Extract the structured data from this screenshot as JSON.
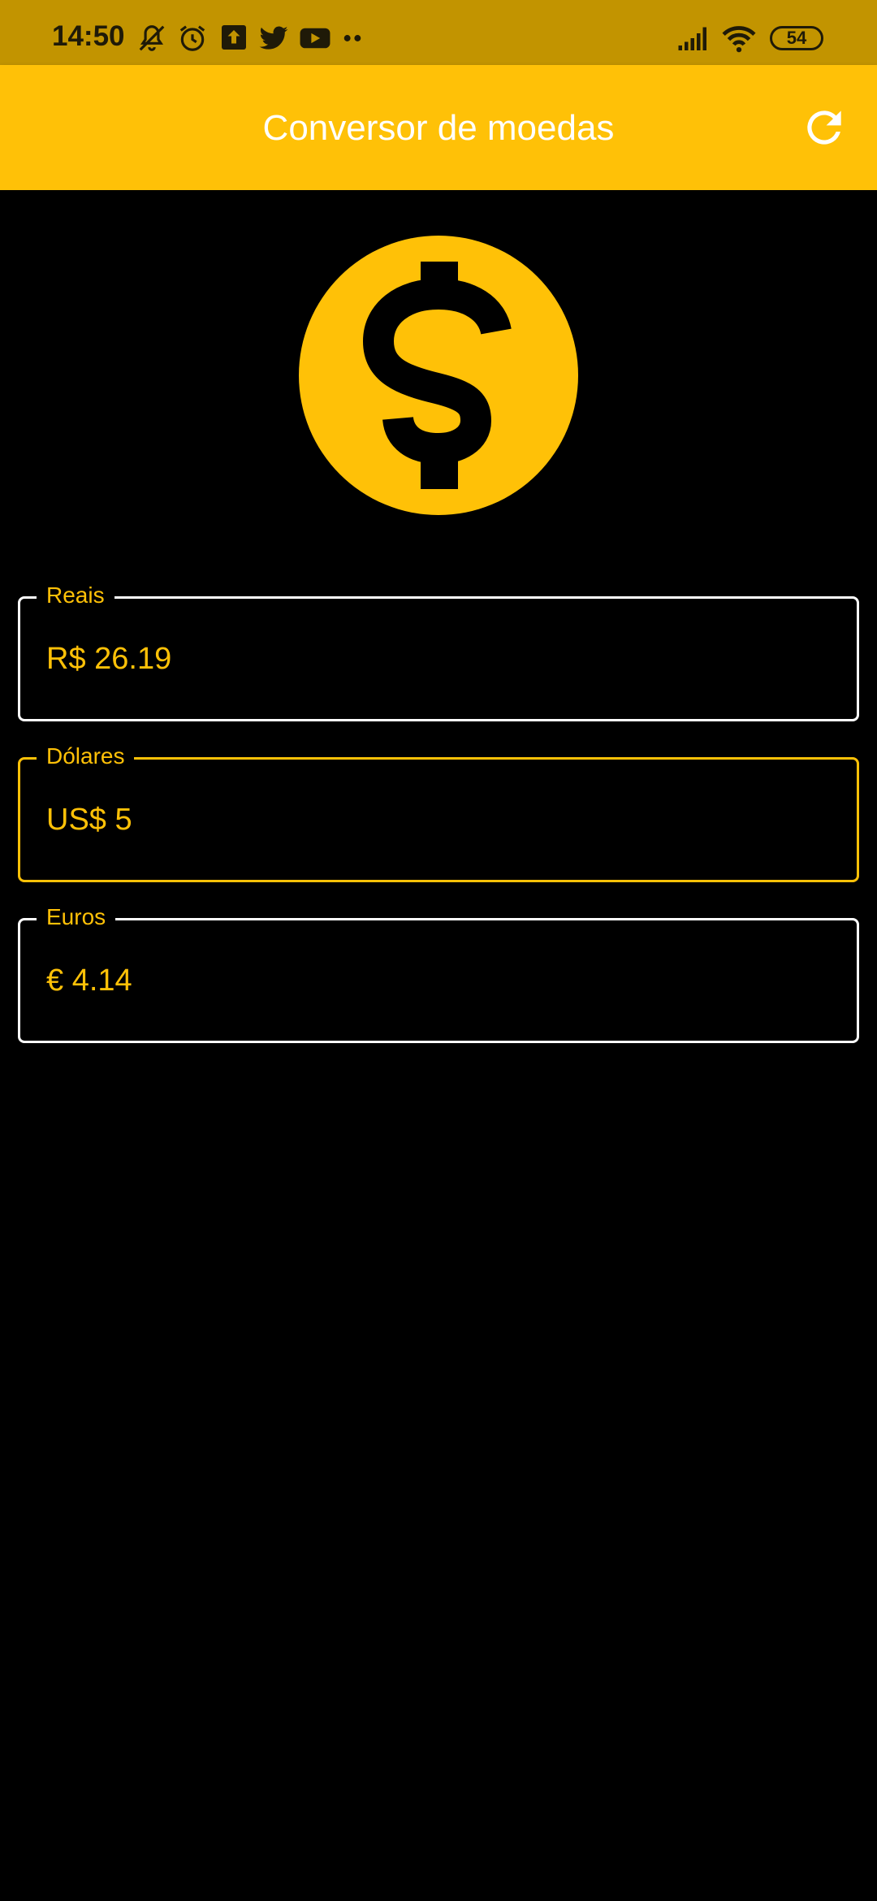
{
  "status_bar": {
    "time": "14:50",
    "battery": "54",
    "icons": [
      "mute-icon",
      "alarm-icon",
      "upload-icon",
      "twitter-icon",
      "youtube-icon",
      "more-dots-icon",
      "signal-icon",
      "wifi-icon",
      "battery-icon"
    ]
  },
  "app_bar": {
    "title": "Conversor de moedas",
    "refresh_icon": "refresh-icon"
  },
  "logo": {
    "icon": "dollar-coin-icon"
  },
  "fields": {
    "reais": {
      "label": "Reais",
      "value": "R$ 26.19"
    },
    "dolares": {
      "label": "Dólares",
      "value": "US$ 5"
    },
    "euros": {
      "label": "Euros",
      "value": "€ 4.14"
    }
  },
  "colors": {
    "accent": "#FFC107",
    "status_bar": "#C29400",
    "background": "#000000",
    "title_text": "#FFFFFF"
  }
}
